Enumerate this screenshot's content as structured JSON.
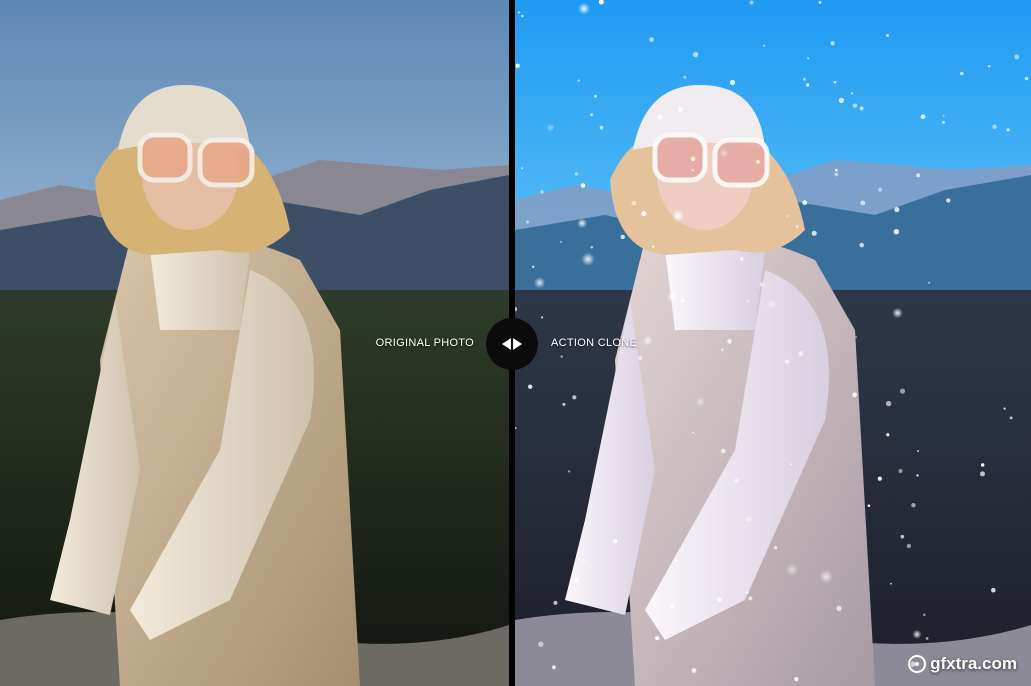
{
  "comparison": {
    "left_label": "ORIGINAL PHOTO",
    "right_label": "ACTION CLONE",
    "handle_icon": "left-right-arrows-icon"
  },
  "watermark": {
    "text": "gfxtra.com",
    "icon": "gfxtra-logo-icon"
  },
  "colors": {
    "sky_original": "#7a9fc4",
    "sky_edited": "#2fa7f0",
    "forest": "#1f2a1c",
    "coat": "#c9b69a",
    "sweater": "#e6dccb",
    "hair": "#d9b77a",
    "snow": "#ffffff"
  }
}
